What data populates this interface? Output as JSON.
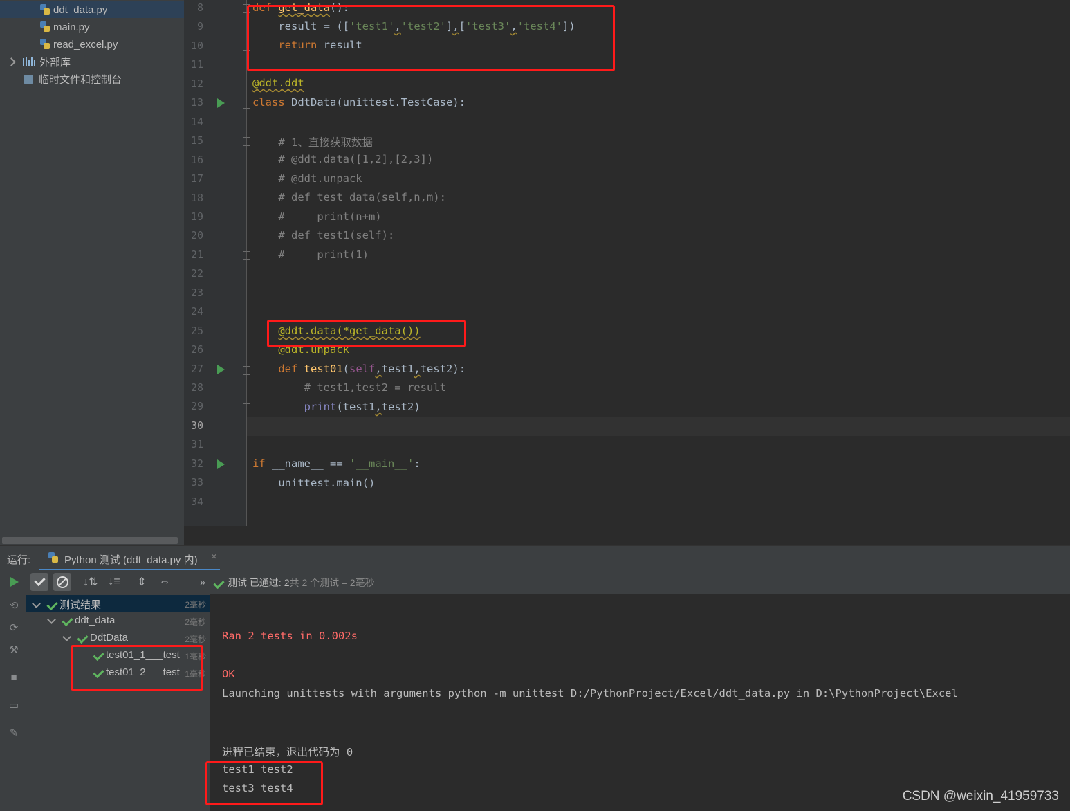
{
  "project_tree": {
    "files": [
      "ddt_data.py",
      "main.py",
      "read_excel.py"
    ],
    "external_libraries": "外部库",
    "scratches": "临时文件和控制台"
  },
  "editor": {
    "line_numbers": [
      "8",
      "9",
      "10",
      "11",
      "12",
      "13",
      "14",
      "15",
      "16",
      "17",
      "18",
      "19",
      "20",
      "21",
      "22",
      "23",
      "24",
      "25",
      "26",
      "27",
      "28",
      "29",
      "30",
      "31",
      "32",
      "33",
      "34"
    ],
    "current_line": "30"
  },
  "run_panel": {
    "label": "运行:",
    "tab_title": "Python 测试 (ddt_data.py 内)",
    "close": "×",
    "status_prefix": "测试 已通过:",
    "status_count": "2",
    "status_suffix": "共 2 个测试 – 2毫秒",
    "more": "»"
  },
  "test_tree": {
    "root": {
      "label": "测试结果",
      "time": "2毫秒"
    },
    "module": {
      "label": "ddt_data",
      "time": "2毫秒"
    },
    "class": {
      "label": "DdtData",
      "time": "2毫秒"
    },
    "tests": [
      {
        "label": "test01_1___test",
        "time": "1毫秒"
      },
      {
        "label": "test01_2___test",
        "time": "1毫秒"
      }
    ]
  },
  "console": {
    "ran": "Ran 2 tests in 0.002s",
    "ok": "OK",
    "launching": "Launching unittests with arguments python -m unittest D:/PythonProject/Excel/ddt_data.py in D:\\PythonProject\\Excel",
    "exit": "进程已结束，退出代码为 0",
    "out1": "test1 test2",
    "out2": "test3 test4"
  },
  "watermark": "CSDN @weixin_41959733",
  "colors": {
    "accent_red": "#ff1a1a",
    "pass_green": "#5fb55f",
    "run_green": "#499c54"
  }
}
